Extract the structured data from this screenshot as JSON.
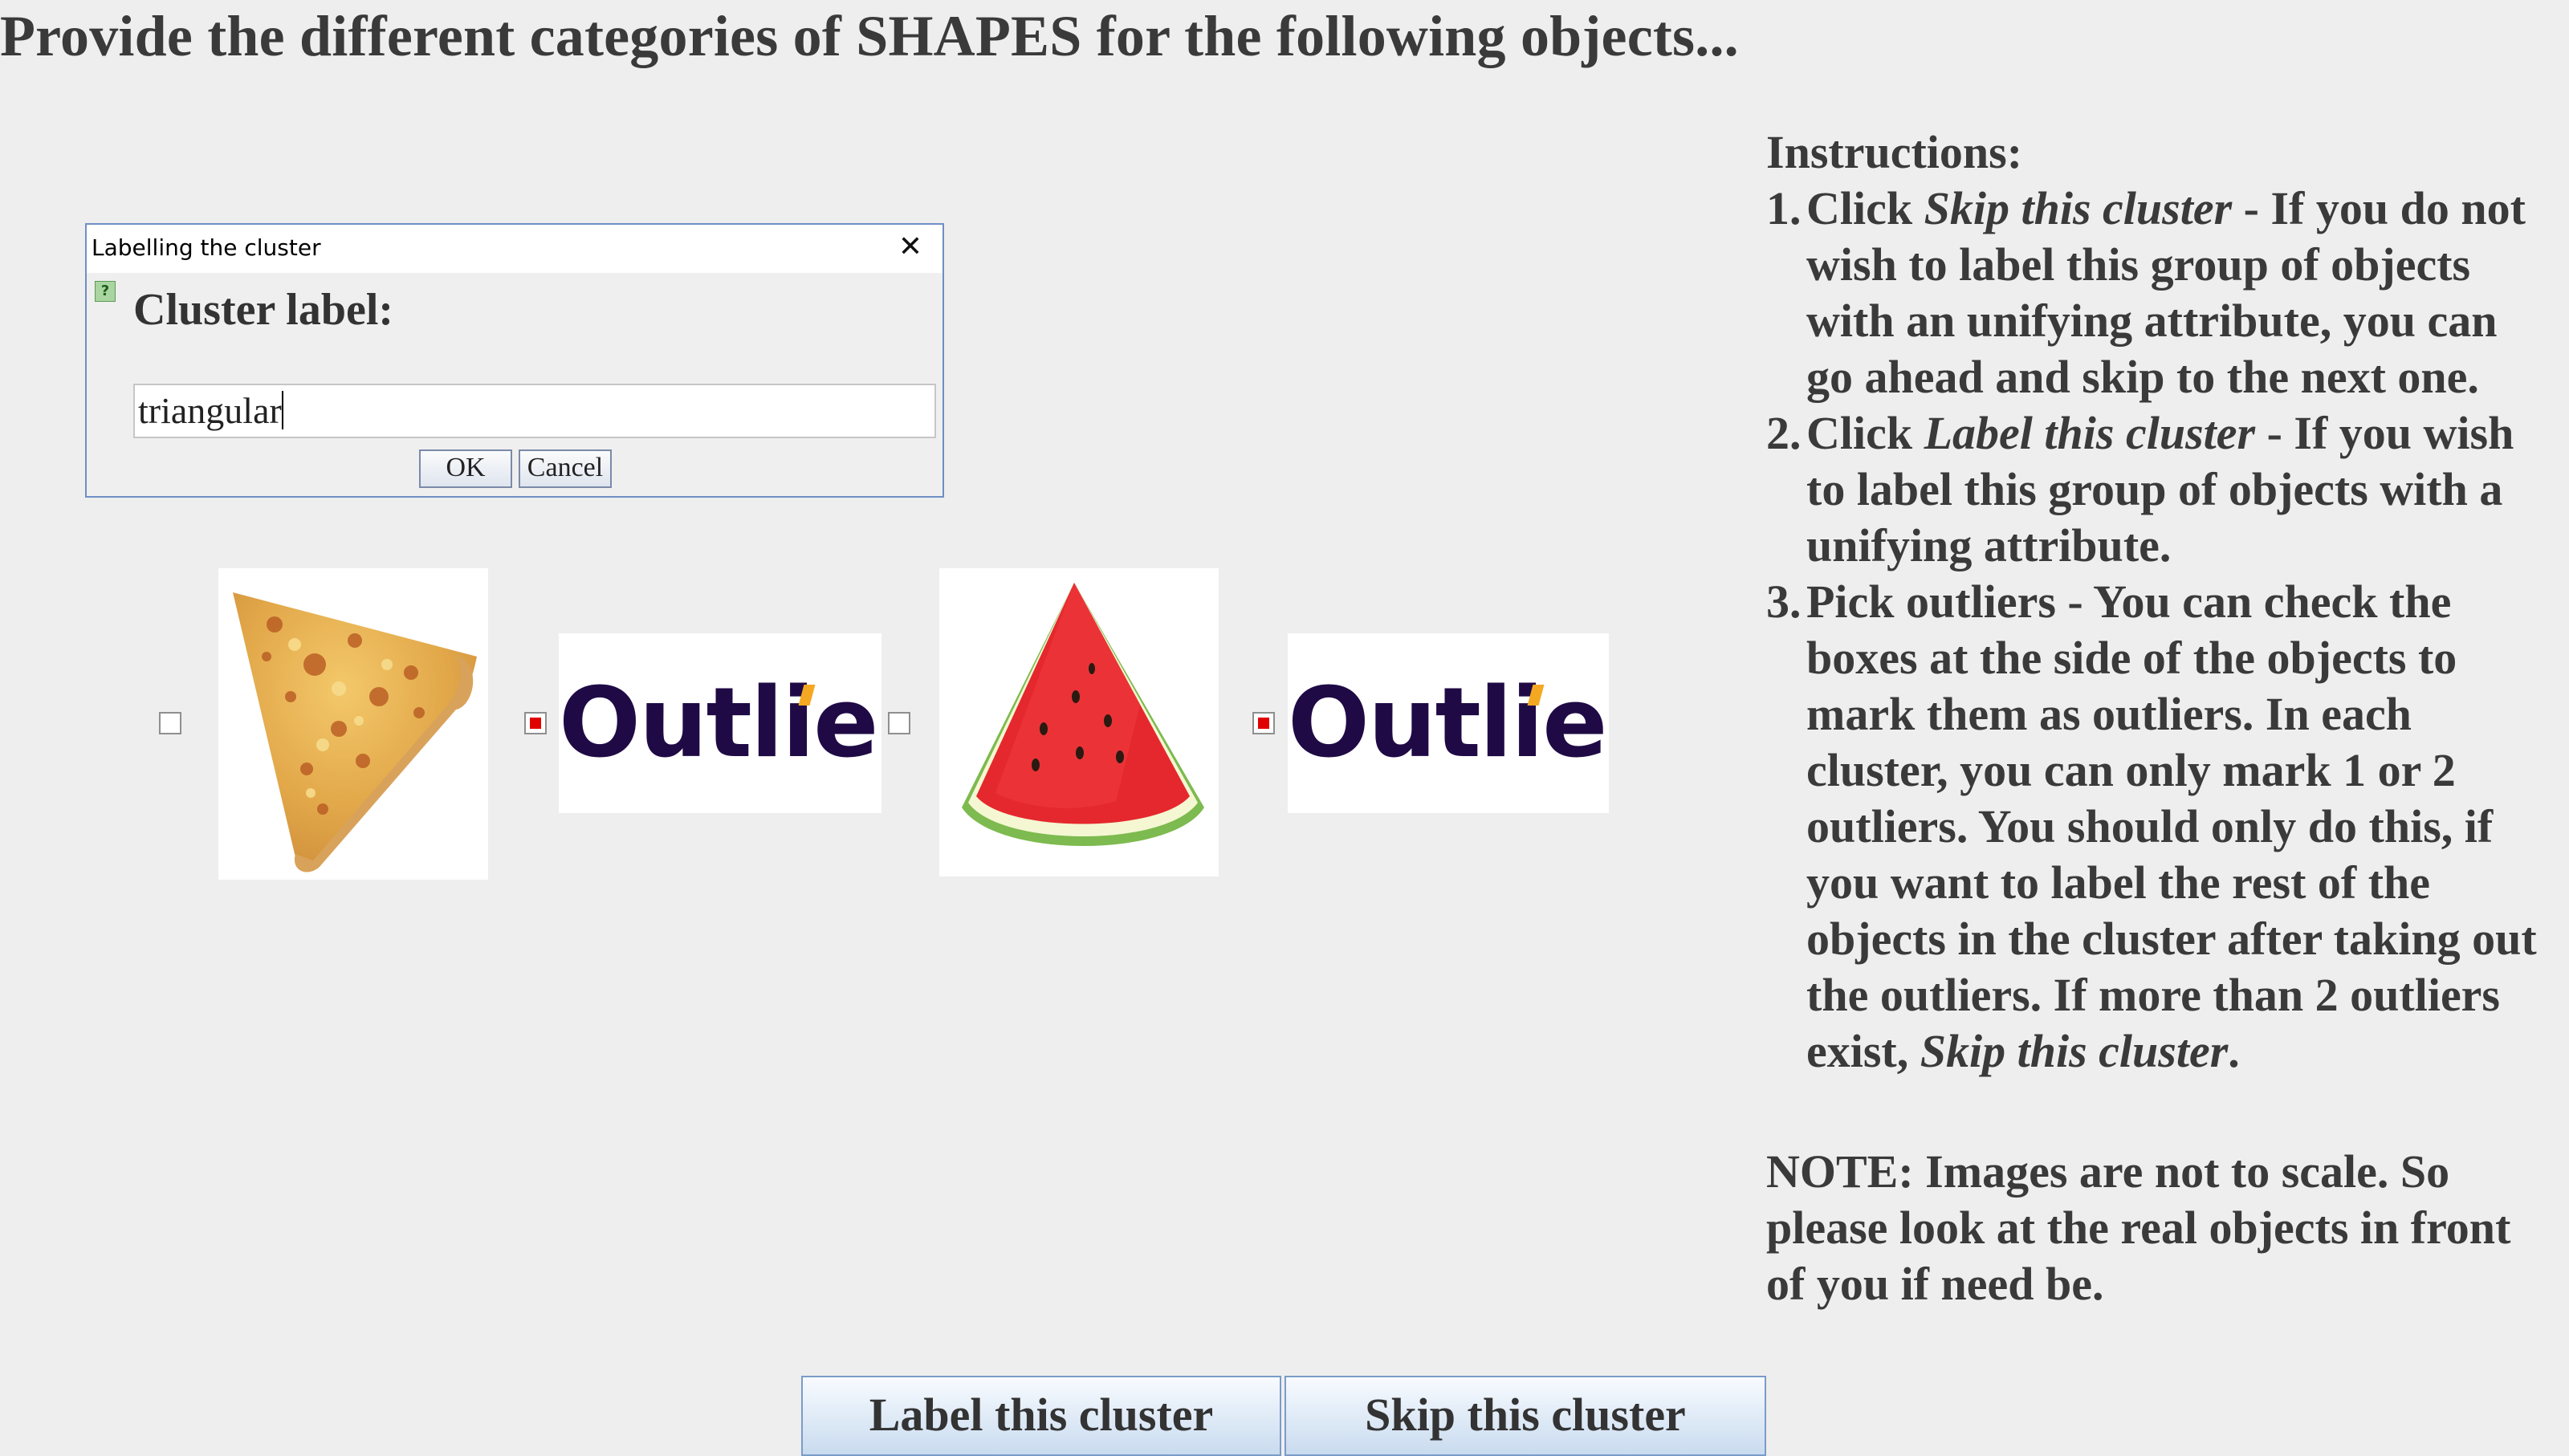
{
  "title": "Provide the different categories of SHAPES for the following objects...",
  "dialog": {
    "title": "Labelling the cluster",
    "close_symbol": "✕",
    "label": "Cluster label:",
    "input_value": "triangular",
    "ok_label": "OK",
    "cancel_label": "Cancel"
  },
  "objects": [
    {
      "checked": false,
      "image": "pizza-slice"
    },
    {
      "checked": true,
      "image": "outlier-logo",
      "text": "Outlier"
    },
    {
      "checked": false,
      "image": "watermelon-slice"
    },
    {
      "checked": true,
      "image": "outlier-logo",
      "text": "Outlier"
    }
  ],
  "instructions": {
    "heading": "Instructions:",
    "items": [
      {
        "num": "1.",
        "prefix": "Click ",
        "emph": "Skip this cluster",
        "text": " - If you do not wish to label this group of objects with an unifying attribute, you can go ahead and skip to the next one."
      },
      {
        "num": "2.",
        "prefix": "Click ",
        "emph": "Label this cluster",
        "text": " - If you wish to label this group of objects with a unifying attribute."
      },
      {
        "num": "3.",
        "prefix": "Pick outliers",
        "text": " - You can check the boxes at the side of the objects to mark them as outliers. In each cluster, you can only mark 1 or 2 outliers. You should only do this, if you want to label the rest of the objects in the cluster after taking out the outliers. If more than 2 outliers exist, ",
        "emph_end": "Skip this cluster",
        "end": "."
      }
    ],
    "note": "NOTE: Images are not to scale. So please look at the real objects in front of you if need be."
  },
  "buttons": {
    "label_cluster": "Label this cluster",
    "skip_cluster": "Skip this cluster"
  },
  "colors": {
    "checked_red": "#e00000",
    "outlier_navy": "#1f0a45",
    "outlier_accent": "#f4a822"
  }
}
